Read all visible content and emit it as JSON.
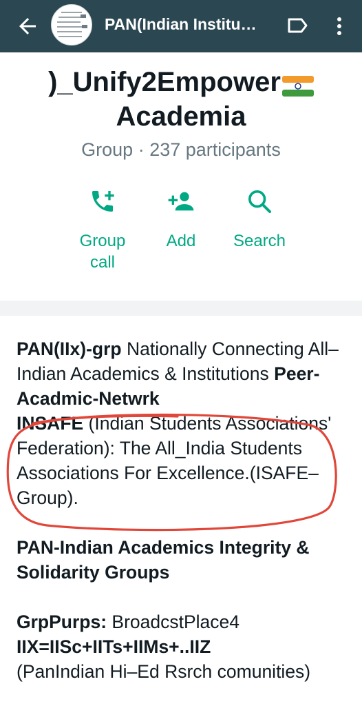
{
  "appbar": {
    "title": "PAN(Indian Institu…",
    "icons": [
      "back-arrow-icon",
      "group-avatar",
      "label-icon",
      "more-vert-icon"
    ]
  },
  "header": {
    "name_line1": ")_Unify2Empower",
    "name_line2": "Academia",
    "flag": "indian-flag-icon",
    "meta": "Group · 237 participants",
    "actions": [
      {
        "label_line1": "Group",
        "label_line2": "call",
        "icon": "add-call-icon"
      },
      {
        "label_line1": "Add",
        "label_line2": "",
        "icon": "person-add-icon"
      },
      {
        "label_line1": "Search",
        "label_line2": "",
        "icon": "search-icon"
      }
    ]
  },
  "description": {
    "p1_bold1": "PAN(IIx)-grp",
    "p1_text1": " Nationally Connecting All–Indian Academics & Institutions ",
    "p1_bold2": "Peer-Acadmic-Netwrk",
    "p1_bold3": "INSAFE",
    "p1_text2": " (Indian Students Associations' Federation): The All_India Students Associations For Excellence.(ISAFE–Group).",
    "p2_bold": "PAN-Indian Academics Integrity & Solidarity Groups",
    "p3_bold1": "GrpPurps:",
    "p3_text1": " BroadcstPlace4",
    "p3_bold2": "IIX=IISc+IITs+IIMs+..IIZ",
    "p3_text2": " (PanIndian Hi–Ed Rsrch comunities)"
  },
  "colors": {
    "appbar": "#2b4752",
    "accent": "#00a884",
    "annotation": "#e0473a"
  }
}
